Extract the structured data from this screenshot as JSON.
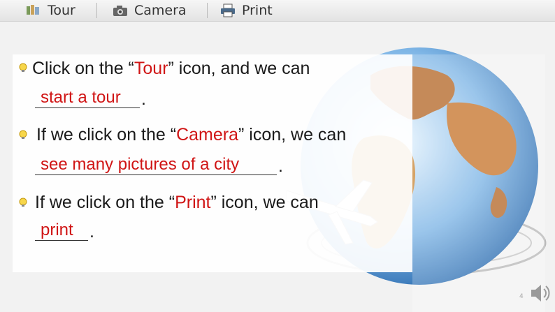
{
  "toolbar": {
    "tour_label": "Tour",
    "camera_label": "Camera",
    "print_label": "Print"
  },
  "content": {
    "line1_pre": "Click on the “",
    "line1_hl": "Tour",
    "line1_post": "” icon, and we can",
    "answer1": "start a tour",
    "line2_pre": "If we click on the “",
    "line2_hl": "Camera",
    "line2_post": "” icon, we can",
    "answer2": "see many pictures of a city",
    "line3_pre": "If we click on the “",
    "line3_hl": "Print",
    "line3_post": "” icon, we can",
    "answer3": "print",
    "period": "."
  },
  "slide": {
    "page_number": "4"
  },
  "icons": [
    "tour-icon",
    "camera-icon",
    "print-icon",
    "bulb-bullet-icon",
    "speaker-icon"
  ],
  "colors": {
    "highlight": "#d01515",
    "text": "#1a1a1a",
    "background": "#f2f2f2"
  }
}
